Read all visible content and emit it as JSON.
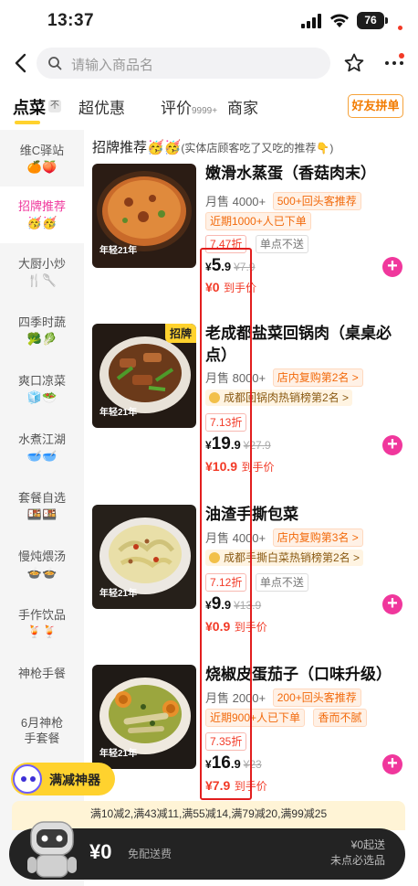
{
  "status_bar": {
    "time": "13:37",
    "battery": "76"
  },
  "search": {
    "placeholder": "请输入商品名"
  },
  "tabs": {
    "items": [
      "点菜",
      "超优惠",
      "评价",
      "商家"
    ],
    "order_badge": "不",
    "review_count": "9999+",
    "group_button": "好友拼单"
  },
  "sidebar": {
    "items": [
      {
        "label": "维C驿站",
        "emoji": "🍊🍑"
      },
      {
        "label": "招牌推荐",
        "emoji": "🥳🥳"
      },
      {
        "label": "大厨小炒",
        "emoji": "🍴🥄"
      },
      {
        "label": "四季时蔬",
        "emoji": "🥦🥬"
      },
      {
        "label": "爽口凉菜",
        "emoji": "🧊🥗"
      },
      {
        "label": "水煮江湖",
        "emoji": "🥣🥣"
      },
      {
        "label": "套餐自选",
        "emoji": "🍱🍱"
      },
      {
        "label": "慢炖煨汤",
        "emoji": "🍲🍲"
      },
      {
        "label": "手作饮品",
        "emoji": "🍹🍹"
      },
      {
        "label": "神枪手餐",
        "emoji": ""
      },
      {
        "label": "6月神枪\n手套餐",
        "emoji": ""
      }
    ]
  },
  "section": {
    "title": "招牌推荐",
    "emoji": "🥳🥳",
    "note": "(实体店顾客吃了又吃的推荐👇)"
  },
  "dishes": [
    {
      "name": "嫩滑水蒸蛋（香菇肉末）",
      "sales": "月售 4000+",
      "tags1": [
        "500+回头客推荐"
      ],
      "tags2": [
        "近期1000+人已下单"
      ],
      "discount": "7.47折",
      "limit": "单点不送",
      "price_int": "5",
      "price_dec": ".9",
      "old_price": "¥7.9",
      "hand_price": "¥0",
      "hand_label": "到手价",
      "badge": ""
    },
    {
      "name": "老成都盐菜回锅肉（桌桌必点）",
      "sales": "月售 8000+",
      "tags1": [
        "店内复购第2名 >"
      ],
      "tags2": [
        "成都回锅肉热销榜第2名 >"
      ],
      "discount": "7.13折",
      "limit": "",
      "price_int": "19",
      "price_dec": ".9",
      "old_price": "¥27.9",
      "hand_price": "¥10.9",
      "hand_label": "到手价",
      "badge": "招牌"
    },
    {
      "name": "油渣手撕包菜",
      "sales": "月售 4000+",
      "tags1": [
        "店内复购第3名 >"
      ],
      "tags2": [
        "成都手撕白菜热销榜第2名 >"
      ],
      "discount": "7.12折",
      "limit": "单点不送",
      "price_int": "9",
      "price_dec": ".9",
      "old_price": "¥13.9",
      "hand_price": "¥0.9",
      "hand_label": "到手价",
      "badge": ""
    },
    {
      "name": "烧椒皮蛋茄子（口味升级）",
      "sales": "月售 2000+",
      "tags1": [
        "200+回头客推荐"
      ],
      "tags2": [
        "近期900+人已下单",
        "香而不腻"
      ],
      "discount": "7.35折",
      "limit": "",
      "price_int": "16",
      "price_dec": ".9",
      "old_price": "¥23",
      "hand_price": "¥7.9",
      "hand_label": "到手价",
      "badge": ""
    }
  ],
  "price_currency": "¥",
  "image_label": "年轻21年",
  "reduction_button": "满减神器",
  "promo_text": "满10减2,满43减11,满55减14,满79减20,满99减25",
  "cart": {
    "amount": "¥0",
    "shipping": "免配送费",
    "min_order": "¥0起送",
    "status": "未点必选品"
  }
}
